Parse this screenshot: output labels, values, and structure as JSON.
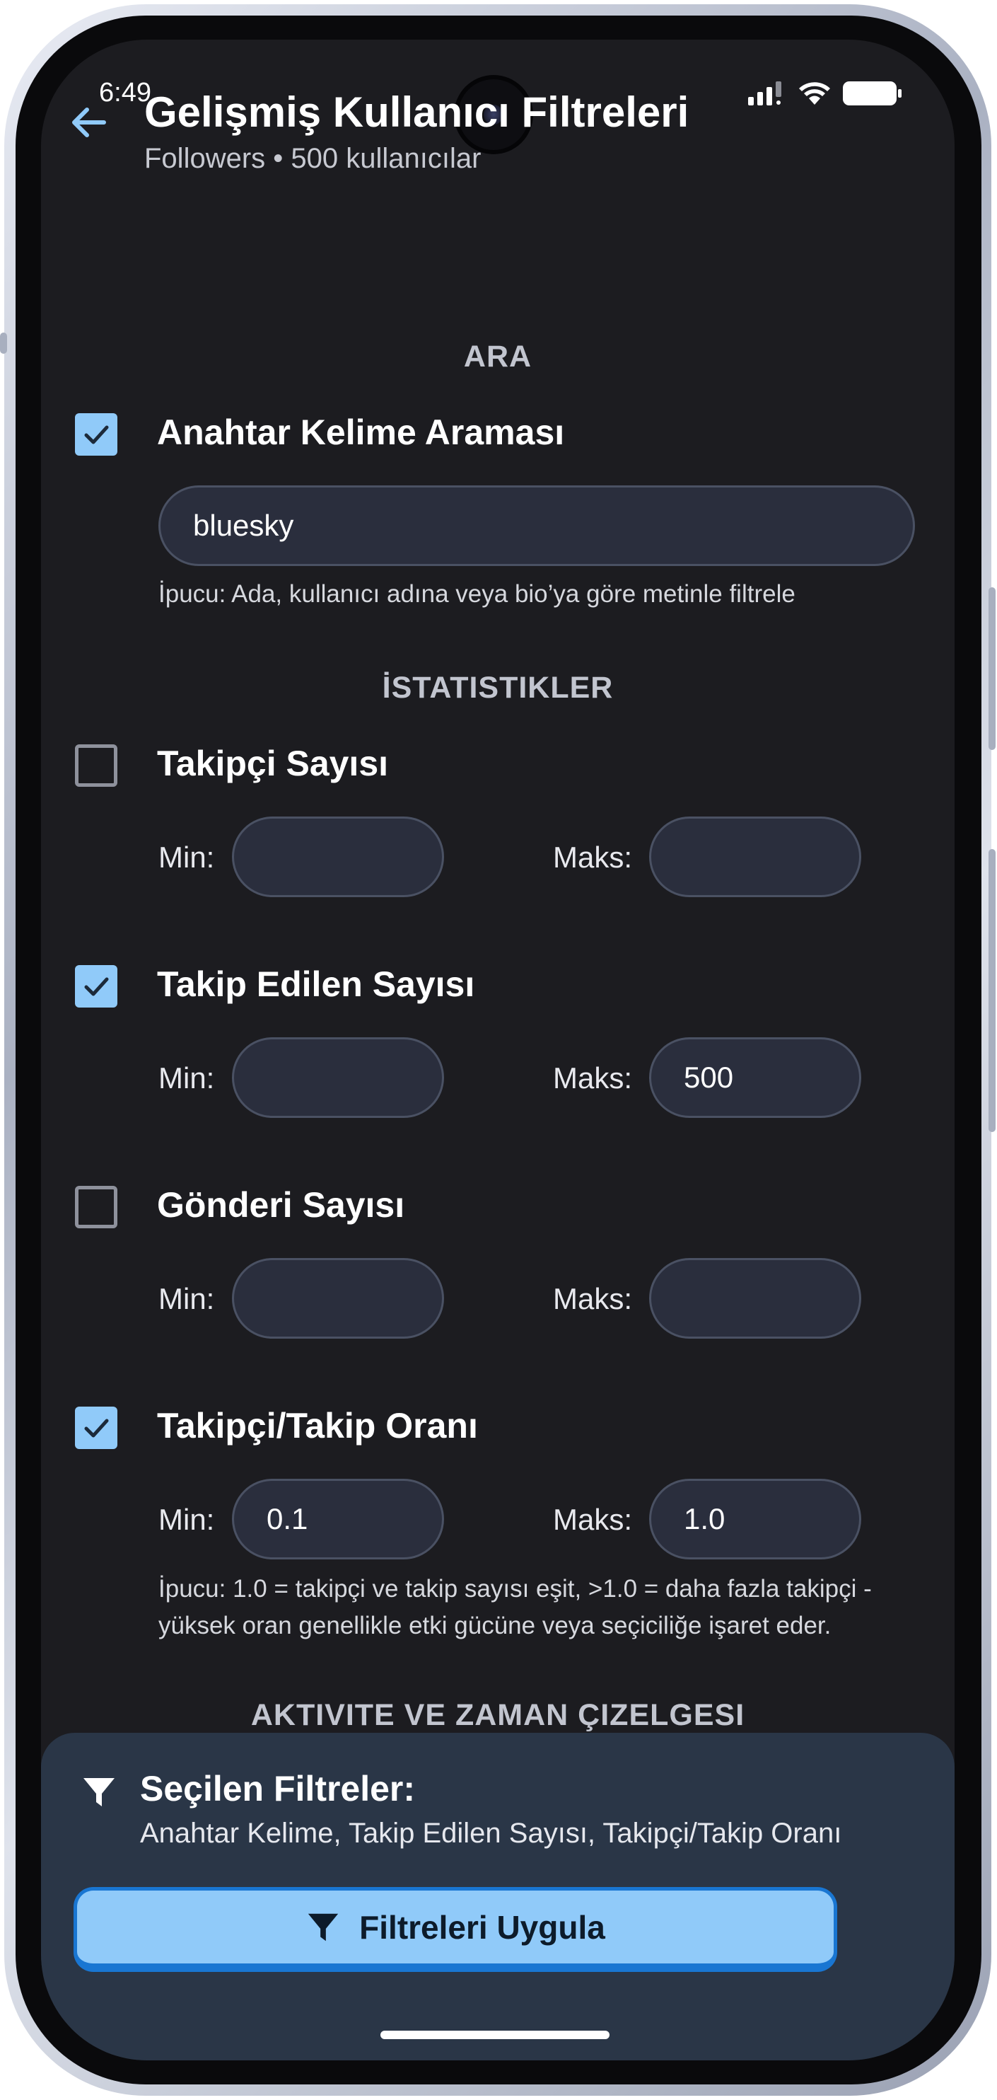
{
  "status_bar": {
    "time": "6:49"
  },
  "header": {
    "title": "Gelişmiş Kullanıcı Filtreleri",
    "subtitle": "Followers • 500 kullanıcılar"
  },
  "sections": {
    "search": "ARA",
    "stats": "İSTATISTIKLER",
    "activity": "AKTIVITE VE ZAMAN ÇIZELGESI"
  },
  "keyword": {
    "label": "Anahtar Kelime Araması",
    "checked": true,
    "value": "bluesky",
    "hint": "İpucu: Ada, kullanıcı adına veya bio’ya göre metinle filtrele"
  },
  "range_labels": {
    "min": "Min:",
    "max": "Maks:"
  },
  "filters": [
    {
      "label": "Takipçi Sayısı",
      "checked": false,
      "min": "",
      "max": ""
    },
    {
      "label": "Takip Edilen Sayısı",
      "checked": true,
      "min": "",
      "max": "500"
    },
    {
      "label": "Gönderi Sayısı",
      "checked": false,
      "min": "",
      "max": ""
    },
    {
      "label": "Takipçi/Takip Oranı",
      "checked": true,
      "min": "0.1",
      "max": "1.0"
    }
  ],
  "ratio_hint": "İpucu: 1.0 = takipçi ve takip sayısı eşit, >1.0 = daha fazla takipçi - yüksek oran genellikle etki gücüne veya seçiciliğe işaret eder.",
  "bottom_sheet": {
    "title": "Seçilen Filtreler:",
    "selected": "Anahtar Kelime, Takip Edilen Sayısı, Takipçi/Takip Oranı",
    "apply_label": "Filtreleri Uygula"
  },
  "colors": {
    "background": "#1c1c20",
    "accent": "#90caf9",
    "field": "#2a2e3d",
    "sheet": "#2a3647",
    "button_border": "#1976d2"
  }
}
